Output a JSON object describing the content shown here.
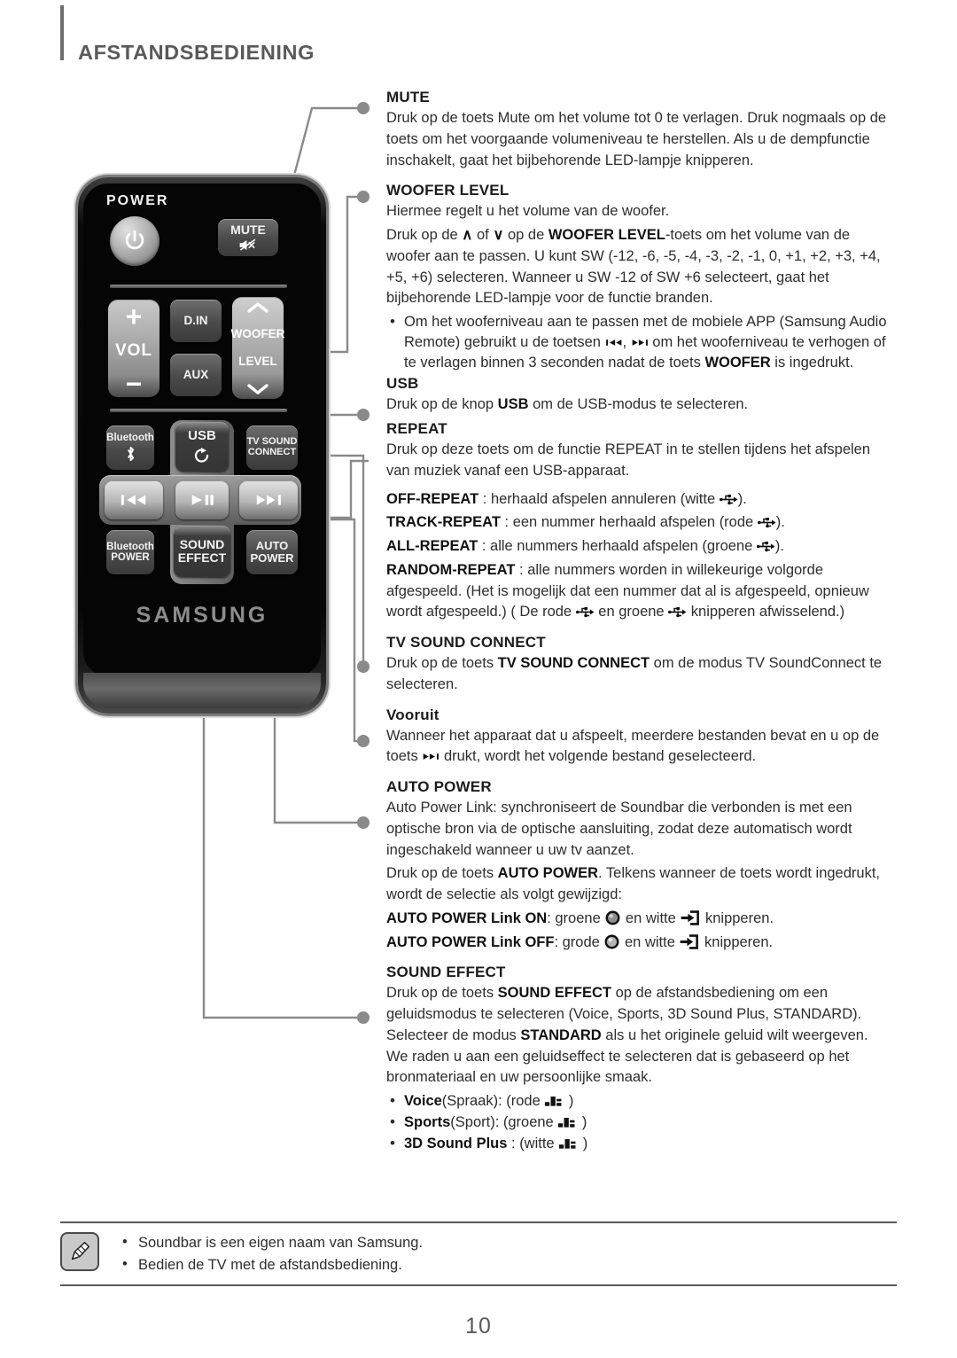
{
  "header": {
    "chapter_title": "AFSTANDSBEDIENING"
  },
  "remote": {
    "brand": "SAMSUNG",
    "power_label": "POWER",
    "buttons": {
      "power": "power-button",
      "mute": "MUTE",
      "vol": "VOL",
      "vol_plus": "+",
      "vol_minus": "−",
      "din": "D.IN",
      "aux": "AUX",
      "woofer_line1": "WOOFER",
      "woofer_line2": "LEVEL",
      "bluetooth": "Bluetooth",
      "usb": "USB",
      "tv_sound_connect_line1": "TV SOUND",
      "tv_sound_connect_line2": "CONNECT",
      "bluetooth_power_line1": "Bluetooth",
      "bluetooth_power_line2": "POWER",
      "sound_effect_line1": "SOUND",
      "sound_effect_line2": "EFFECT",
      "auto_power_line1": "AUTO",
      "auto_power_line2": "POWER",
      "prev": "previous-track",
      "play_pause": "play-pause",
      "next": "next-track"
    }
  },
  "sections": {
    "mute": {
      "title": "MUTE",
      "p1": "Druk op de toets Mute om het volume tot 0 te verlagen. Druk nogmaals op de toets om het voorgaande volumeniveau te herstellen. Als u de dempfunctie inschakelt, gaat het bijbehorende LED-lampje knipperen."
    },
    "woofer": {
      "title": "WOOFER LEVEL",
      "p1": "Hiermee regelt u het volume van de woofer.",
      "p2_a": "Druk op de ",
      "p2_up": "∧",
      "p2_b": " of ",
      "p2_down": "∨",
      "p2_c": " op de ",
      "p2_bold": "WOOFER LEVEL",
      "p2_d": "-toets om het volume van de woofer aan te passen. U kunt SW (-12, -6, -5, -4, -3, -2, -1, 0, +1, +2, +3, +4, +5, +6) selecteren. Wanneer u SW -12 of SW +6 selecteert, gaat het bijbehorende LED-lampje voor de functie branden.",
      "bullet_a": "Om het wooferniveau aan te passen met de mobiele APP (Samsung Audio Remote) gebruikt u de toetsen ",
      "bullet_b": ", ",
      "bullet_c": " om het wooferniveau te verhogen of te verlagen binnen 3 seconden nadat de toets ",
      "bullet_bold": "WOOFER",
      "bullet_d": " is ingedrukt."
    },
    "usb": {
      "title": "USB",
      "p1_a": "Druk op de knop ",
      "p1_bold": "USB",
      "p1_b": " om de USB-modus te selecteren."
    },
    "repeat": {
      "title": "REPEAT",
      "p1": "Druk op deze toets om de functie REPEAT in te stellen tijdens het afspelen van muziek vanaf een USB-apparaat.",
      "off_label": "OFF-REPEAT",
      "off_text_a": " : herhaald afspelen annuleren (witte ",
      "off_text_b": ").",
      "track_label": "TRACK-REPEAT",
      "track_text_a": " : een nummer herhaald afspelen (rode ",
      "track_text_b": ").",
      "all_label": "ALL-REPEAT",
      "all_text_a": " : alle nummers herhaald afspelen (groene ",
      "all_text_b": ").",
      "random_label": "RANDOM-REPEAT",
      "random_text_a": " : alle nummers worden in willekeurige volgorde afgespeeld. (Het is mogelijk dat een nummer dat al is afgespeeld, opnieuw wordt afgespeeld.) ( De rode ",
      "random_text_b": " en groene ",
      "random_text_c": " knipperen afwisselend.)"
    },
    "tv_sound_connect": {
      "title": "TV SOUND CONNECT",
      "p1_a": "Druk op de toets ",
      "p1_bold": "TV SOUND CONNECT",
      "p1_b": " om de modus TV SoundConnect te selecteren."
    },
    "vooruit": {
      "title": "Vooruit",
      "p1_a": "Wanneer het apparaat dat u afspeelt, meerdere bestanden bevat en u op de toets ",
      "p1_b": " drukt, wordt het volgende bestand geselecteerd."
    },
    "auto_power": {
      "title": "AUTO POWER",
      "p1": "Auto Power Link: synchroniseert de Soundbar die verbonden is met een optische bron via de optische aansluiting, zodat deze automatisch wordt ingeschakeld wanneer u uw tv aanzet.",
      "p2_a": "Druk op de toets ",
      "p2_bold": "AUTO POWER",
      "p2_b": ". Telkens wanneer de toets wordt ingedrukt, wordt de selectie als volgt gewijzigd:",
      "on_label": "AUTO POWER Link ON",
      "on_text_a": ": groene ",
      "on_text_b": " en witte ",
      "on_text_c": " knipperen.",
      "off_label": "AUTO POWER Link OFF",
      "off_text_a": ": grode ",
      "off_text_b": " en witte ",
      "off_text_c": " knipperen."
    },
    "sound_effect": {
      "title": "SOUND EFFECT",
      "p1_a": "Druk op de toets ",
      "p1_bold1": "SOUND EFFECT",
      "p1_b": " op de afstandsbediening om een geluidsmodus te selecteren (Voice, Sports, 3D Sound Plus, STANDARD). Selecteer de modus ",
      "p1_bold2": "STANDARD",
      "p1_c": " als u het originele geluid wilt weergeven. We raden u aan een geluidseffect te selecteren dat is gebaseerd op het bronmateriaal en uw persoonlijke smaak.",
      "modes": [
        {
          "bold": "Voice",
          "plain": "(Spraak): (rode ",
          "suffix": " )"
        },
        {
          "bold": "Sports",
          "plain": "(Sport): (groene ",
          "suffix": " )"
        },
        {
          "bold": "3D Sound Plus",
          "plain": " : (witte ",
          "suffix": " )"
        }
      ]
    }
  },
  "note": {
    "items": [
      "Soundbar is een eigen naam van Samsung.",
      "Bedien de TV met de afstandsbediening."
    ]
  },
  "footer": {
    "page_number": "10"
  },
  "colors": {
    "header_text": "#5a5a5a",
    "body_text": "#2e2e2e",
    "leader_line": "#8a8a8a",
    "rule": "#585858"
  }
}
